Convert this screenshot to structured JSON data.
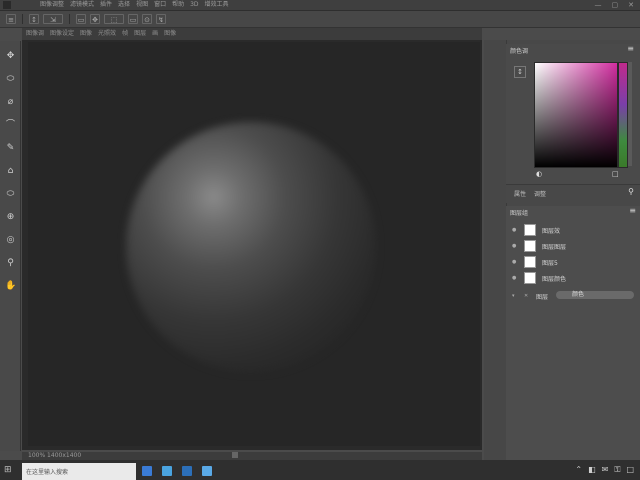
{
  "menubar": {
    "items": [
      "图像调整",
      "滤镜模式",
      "插件",
      "选择",
      "视图",
      "窗口",
      "帮助",
      "3D",
      "增效工具"
    ],
    "window_controls": [
      "—",
      "▢",
      "✕"
    ]
  },
  "optionsbar": {
    "tools": [
      "≡",
      "↕",
      "⇲",
      "▭",
      "✥",
      "⬚",
      "▭",
      "⊙",
      "↯"
    ]
  },
  "tabs": [
    "图像调",
    "图像设定",
    "图像",
    "光照效",
    "帧",
    "图层",
    "画",
    "图像"
  ],
  "toolbar": {
    "tools": [
      "✥",
      "⬭",
      "⌀",
      "⌒",
      "✎",
      "⌂",
      "⬭",
      "⊕",
      "◎",
      "⚲",
      "✋"
    ]
  },
  "canvas": {
    "doc_info": "100% 1400x1400"
  },
  "color_panel": {
    "title": "颜色调",
    "swap_label": "↕",
    "fg_icon": "◐",
    "bg_icon": "□"
  },
  "properties": {
    "tab1": "属性",
    "tab2": "调整",
    "icon": "⚲"
  },
  "layers": {
    "title": "图层组",
    "rows": [
      {
        "label": "图层效",
        "eye": "●"
      },
      {
        "label": "图层图层",
        "eye": "●"
      },
      {
        "label": "图层5",
        "eye": "●"
      },
      {
        "label": "图层颜色",
        "eye": "●"
      }
    ],
    "active_row_label": "图层",
    "active_row_pill": "颜色"
  },
  "taskbar": {
    "search_placeholder": "在这里输入搜索",
    "app_colors": [
      "#3a7bd5",
      "#4aa3df",
      "#2c6fb8",
      "#5aa9e6"
    ],
    "tray": [
      "⌃",
      "◧",
      "✉",
      "⚿",
      "□"
    ]
  }
}
